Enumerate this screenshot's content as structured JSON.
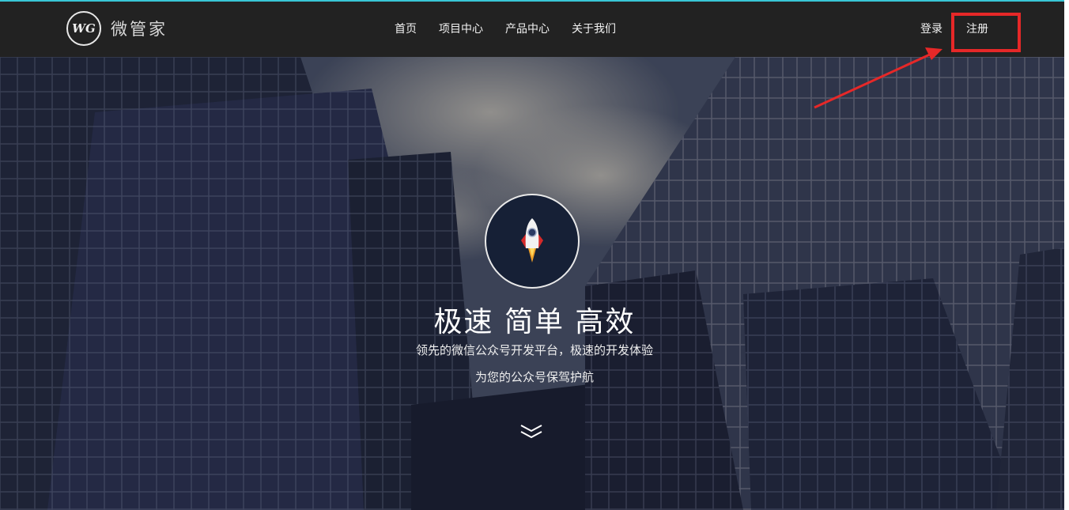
{
  "brand": {
    "logo_mark": "WG",
    "name": "微管家"
  },
  "nav": {
    "items": [
      {
        "label": "首页"
      },
      {
        "label": "项目中心"
      },
      {
        "label": "产品中心"
      },
      {
        "label": "关于我们"
      }
    ],
    "login": "登录",
    "register": "注册"
  },
  "hero": {
    "title": "极速 简单 高效",
    "line1": "领先的微信公众号开发平台，极速的开发体验",
    "line2": "为您的公众号保驾护航",
    "badge_icon": "rocket-icon",
    "scroll_icon": "double-chevron-down-icon"
  },
  "annotation": {
    "highlight_color": "#e62828"
  },
  "colors": {
    "navbar_bg": "#222222",
    "accent": "#39c6d6"
  }
}
